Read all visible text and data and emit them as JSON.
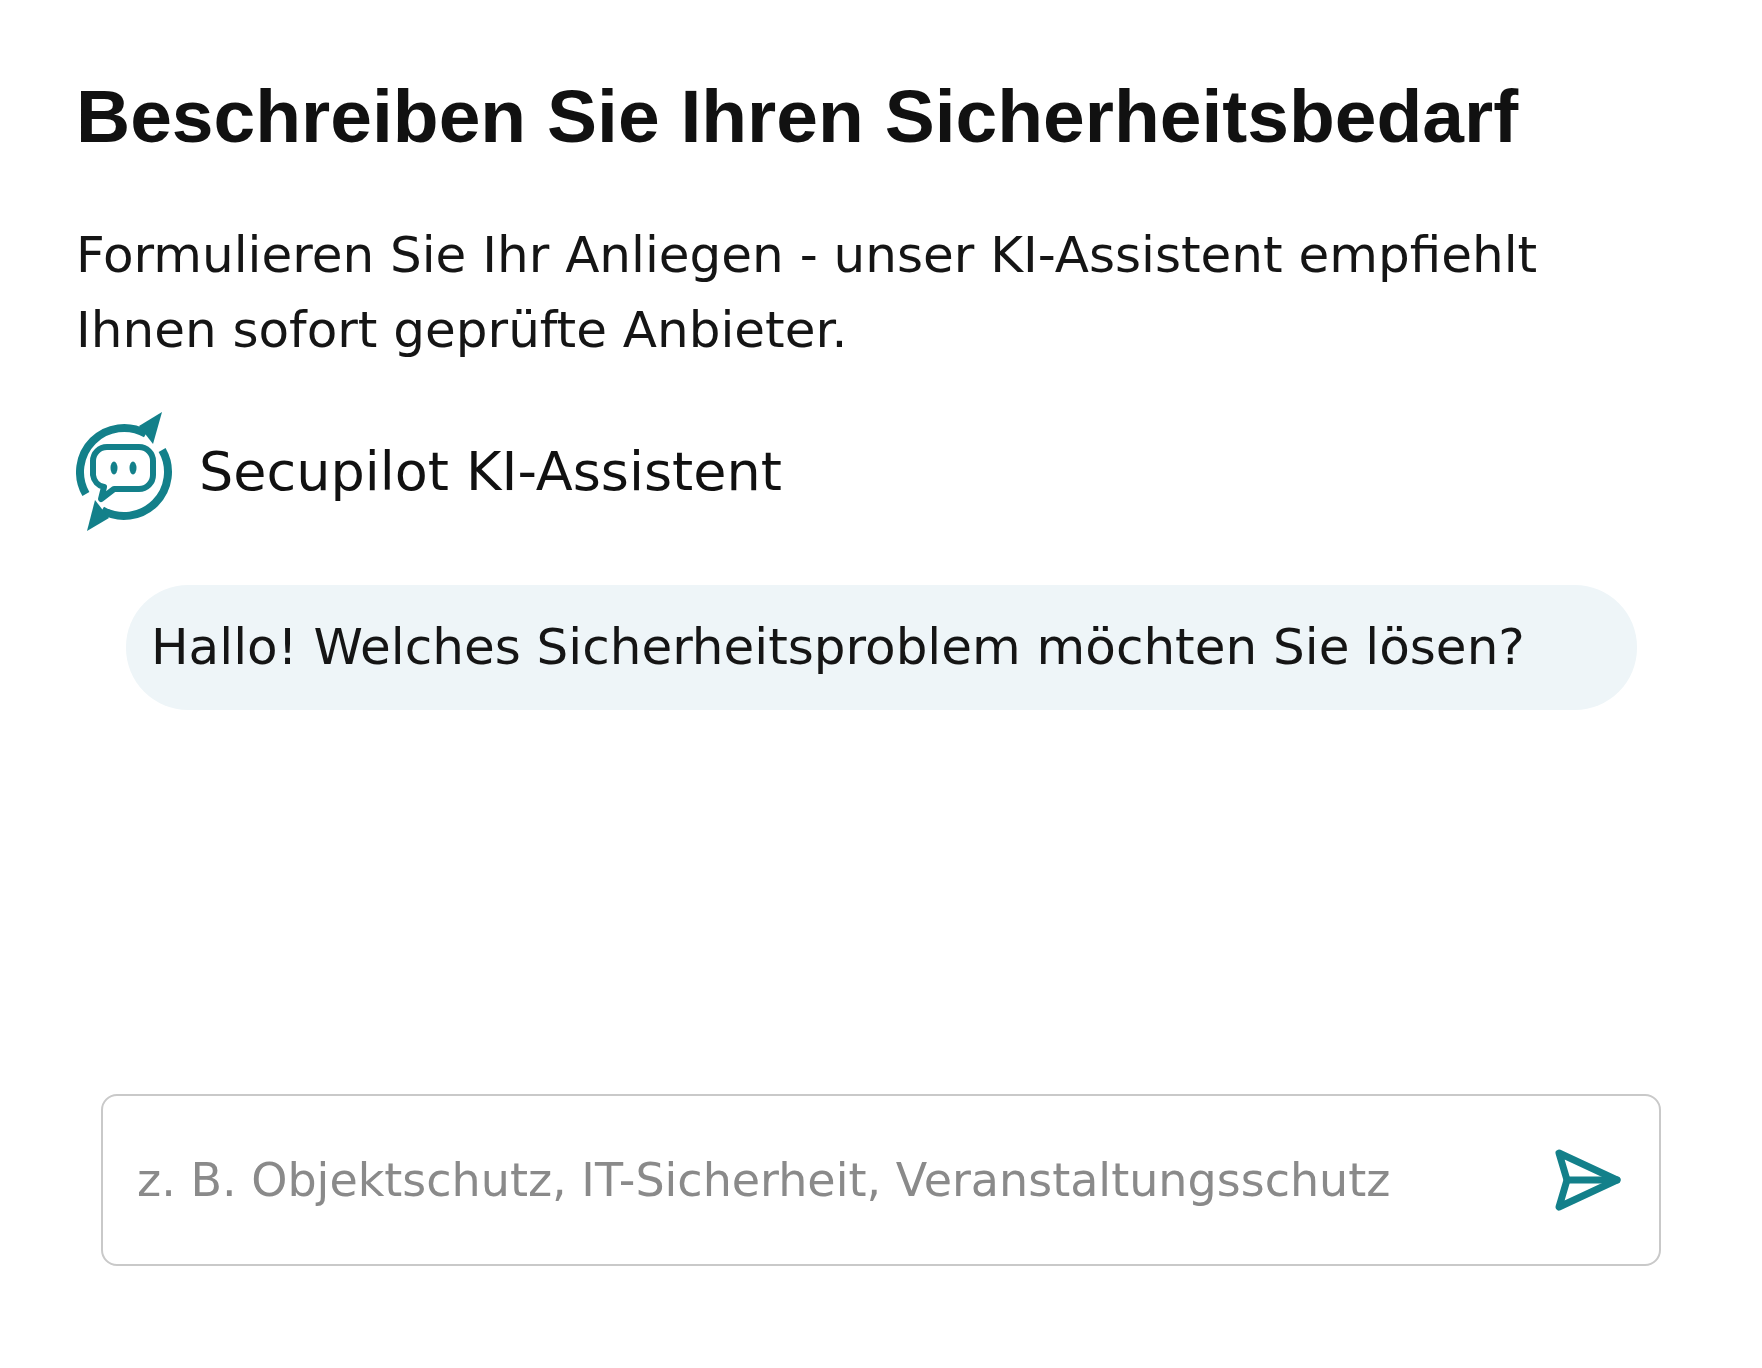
{
  "heading": {
    "title": "Beschreiben Sie Ihren Sicherheitsbedarf",
    "description": "Formulieren Sie Ihr Anliegen - unser KI-Assistent empfiehlt Ihnen sofort geprüfte Anbieter."
  },
  "assistant": {
    "name": "Secupilot KI-Assistent"
  },
  "messages": [
    {
      "kind": "assistant",
      "text": "Hallo! Welches Sicherheitsproblem möchten Sie lösen?"
    }
  ],
  "composer": {
    "placeholder": "z. B. Objektschutz, IT-Sicherheit, Veranstaltungsschutz"
  }
}
